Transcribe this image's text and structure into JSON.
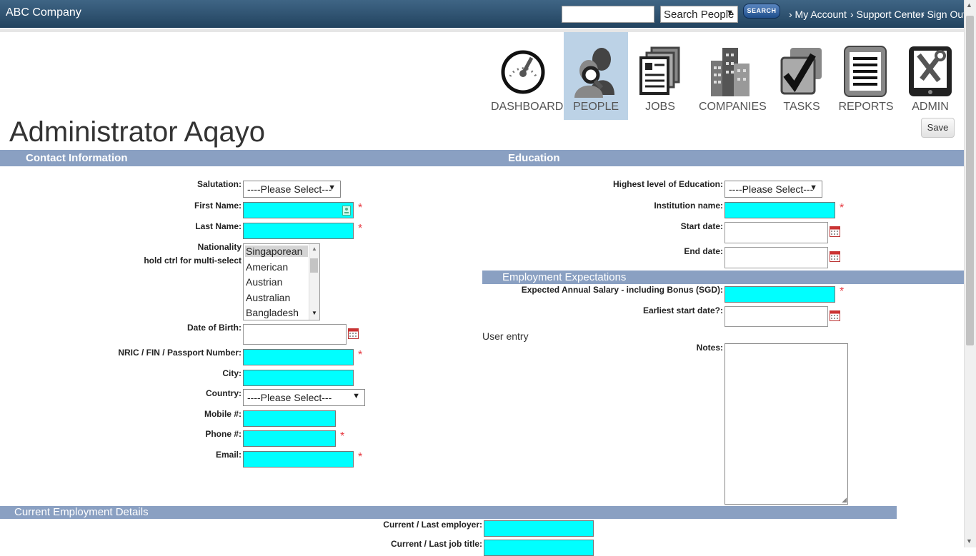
{
  "header": {
    "brand": "ABC Company",
    "search_placeholder": "",
    "search_scope": "Search People",
    "search_button": "SEARCH",
    "links": [
      "› My Account",
      "› Support Center",
      "› Sign Out"
    ]
  },
  "nav": [
    {
      "label": "DASHBOARD",
      "icon": "gauge-icon",
      "active": false
    },
    {
      "label": "PEOPLE",
      "icon": "people-icon",
      "active": true
    },
    {
      "label": "JOBS",
      "icon": "resume-stack-icon",
      "active": false
    },
    {
      "label": "COMPANIES",
      "icon": "buildings-icon",
      "active": false
    },
    {
      "label": "TASKS",
      "icon": "checkbox-icon",
      "active": false
    },
    {
      "label": "REPORTS",
      "icon": "report-icon",
      "active": false
    },
    {
      "label": "ADMIN",
      "icon": "tools-icon",
      "active": false
    }
  ],
  "page": {
    "title": "Administrator Aqayo",
    "save_label": "Save"
  },
  "contact": {
    "heading": "Contact Information",
    "salutation_label": "Salutation:",
    "salutation_value": "----Please Select---",
    "first_name_label": "First Name:",
    "last_name_label": "Last Name:",
    "nationality_label": "Nationality",
    "nationality_hint": "hold ctrl for multi-select",
    "nationality_options": [
      "Singaporean",
      "American",
      "Austrian",
      "Australian",
      "Bangladesh"
    ],
    "dob_label": "Date of Birth:",
    "nric_label": "NRIC / FIN / Passport Number:",
    "city_label": "City:",
    "country_label": "Country:",
    "country_value": "----Please Select---",
    "mobile_label": "Mobile #:",
    "phone_label": "Phone #:",
    "email_label": "Email:",
    "required_mark": "*"
  },
  "education": {
    "heading": "Education",
    "highest_label": "Highest level of Education:",
    "highest_value": "----Please Select---",
    "institution_label": "Institution name:",
    "start_label": "Start date:",
    "end_label": "End date:"
  },
  "expectations": {
    "heading": "Employment Expectations",
    "salary_label": "Expected Annual Salary - including Bonus (SGD):",
    "earliest_label": "Earliest start date?:",
    "user_entry": "User entry",
    "notes_label": "Notes:"
  },
  "employment": {
    "heading": "Current Employment Details",
    "employer_label": "Current / Last employer:",
    "job_title_label": "Current / Last job title:"
  },
  "colors": {
    "topbar": "#2f5576",
    "section_header": "#8aa0c2",
    "required_input": "#00ffff",
    "active_nav": "#bcd2e6"
  }
}
